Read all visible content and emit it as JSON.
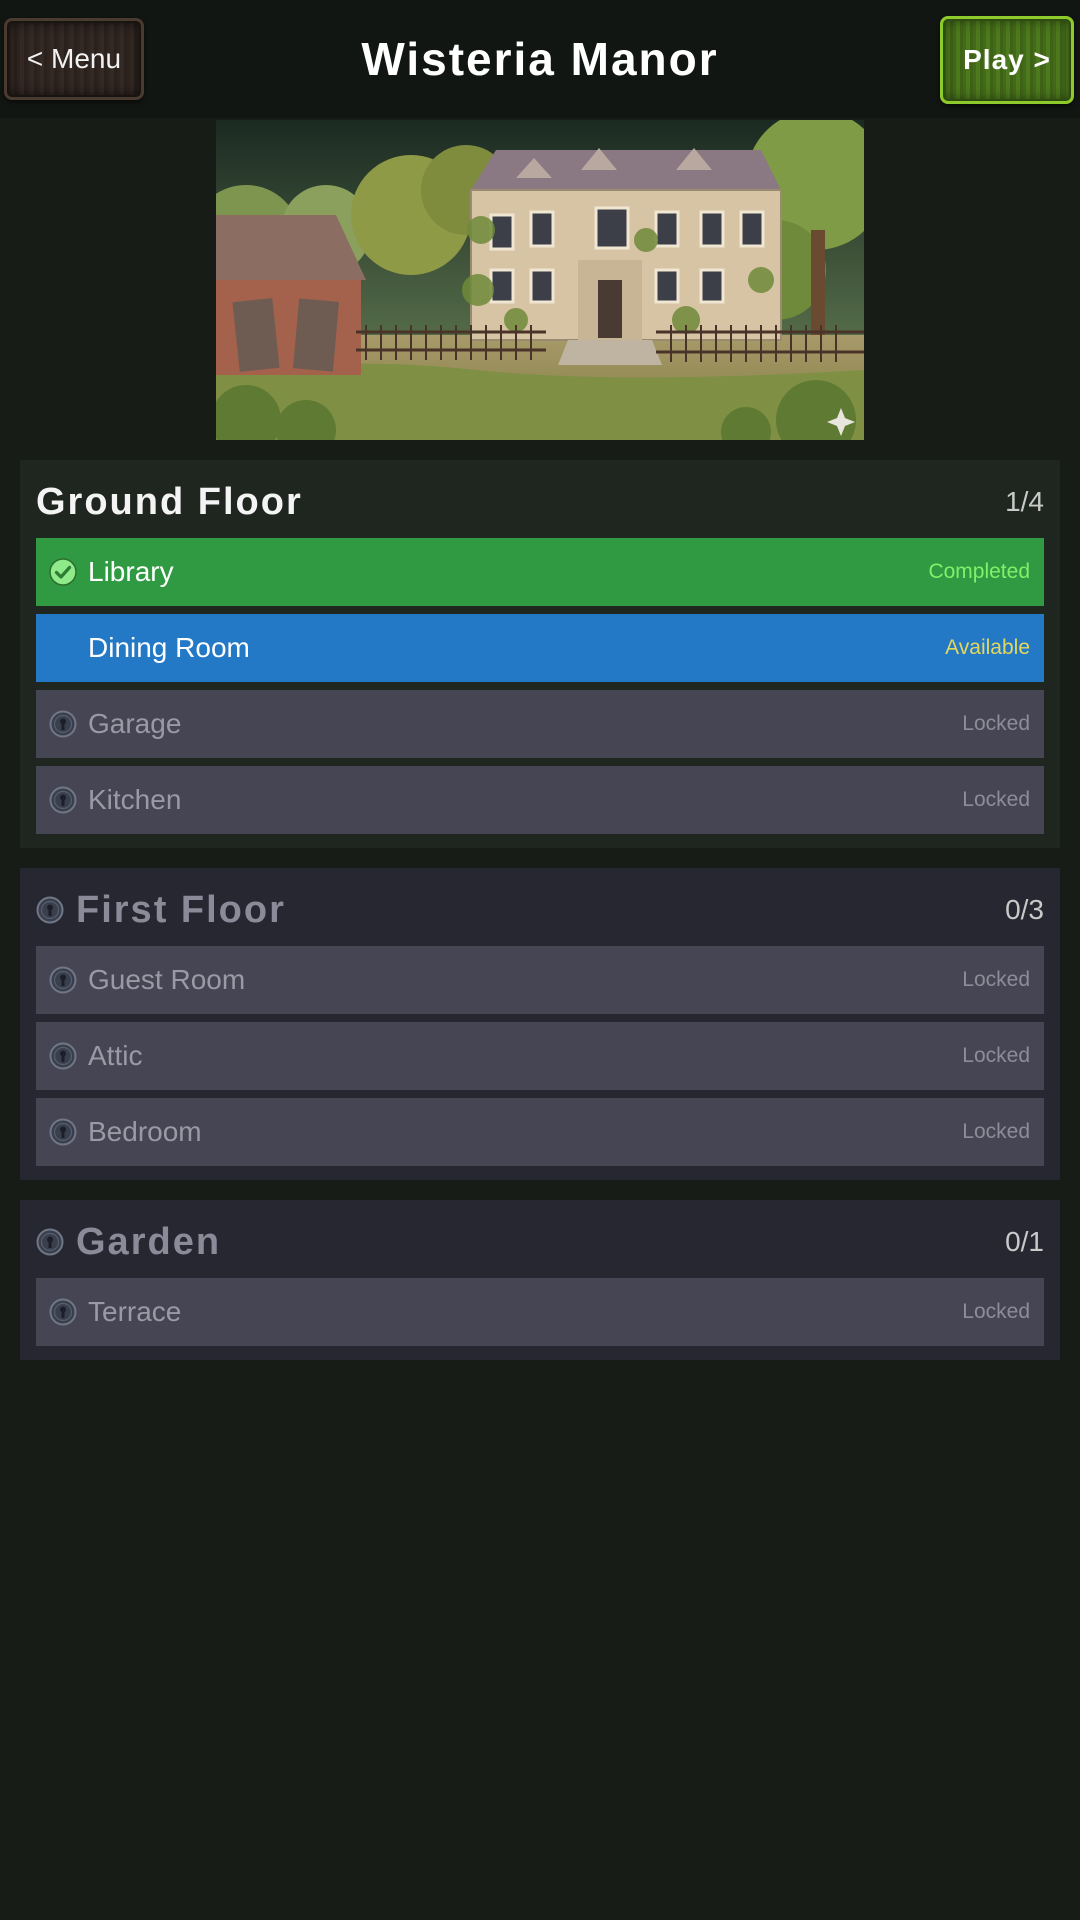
{
  "header": {
    "title": "Wisteria Manor",
    "menu_button": "< Menu",
    "play_button": "Play >"
  },
  "illustration": {
    "subject": "manor-house-illustration"
  },
  "colors": {
    "completed": "#309a42",
    "available": "#2479c7",
    "locked": "#464553",
    "completed_text": "#7ff06a",
    "available_text": "#e3d85b"
  },
  "floors": [
    {
      "name": "Ground Floor",
      "progress": "1/4",
      "locked": false,
      "rooms": [
        {
          "name": "Library",
          "status": "Completed",
          "icon": "check-icon"
        },
        {
          "name": "Dining Room",
          "status": "Available",
          "icon": ""
        },
        {
          "name": "Garage",
          "status": "Locked",
          "icon": "lock-icon"
        },
        {
          "name": "Kitchen",
          "status": "Locked",
          "icon": "lock-icon"
        }
      ]
    },
    {
      "name": "First Floor",
      "progress": "0/3",
      "locked": true,
      "rooms": [
        {
          "name": "Guest Room",
          "status": "Locked",
          "icon": "lock-icon"
        },
        {
          "name": "Attic",
          "status": "Locked",
          "icon": "lock-icon"
        },
        {
          "name": "Bedroom",
          "status": "Locked",
          "icon": "lock-icon"
        }
      ]
    },
    {
      "name": "Garden",
      "progress": "0/1",
      "locked": true,
      "rooms": [
        {
          "name": "Terrace",
          "status": "Locked",
          "icon": "lock-icon"
        }
      ]
    }
  ]
}
